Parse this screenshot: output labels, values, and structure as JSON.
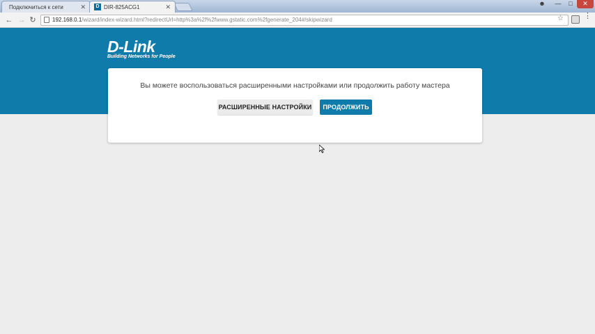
{
  "browser": {
    "tabs": [
      {
        "label": "Подключиться к сети",
        "active": false
      },
      {
        "label": "DIR-825ACG1",
        "active": true,
        "favicon": "D"
      }
    ],
    "url_host": "192.168.0.1",
    "url_path": "/wizard/index-wizard.html?redirectUrl=http%3a%2f%2fwww.gstatic.com%2fgenerate_204#/skipwizard"
  },
  "header": {
    "logo_text": "D-Link",
    "logo_tagline": "Building Networks for People",
    "brand_color": "#0e7bab"
  },
  "dialog": {
    "message": "Вы можете воспользоваться расширенными настройками или продолжить работу мастера",
    "advanced_label": "РАСШИРЕННЫЕ НАСТРОЙКИ",
    "continue_label": "ПРОДОЛЖИТЬ"
  }
}
